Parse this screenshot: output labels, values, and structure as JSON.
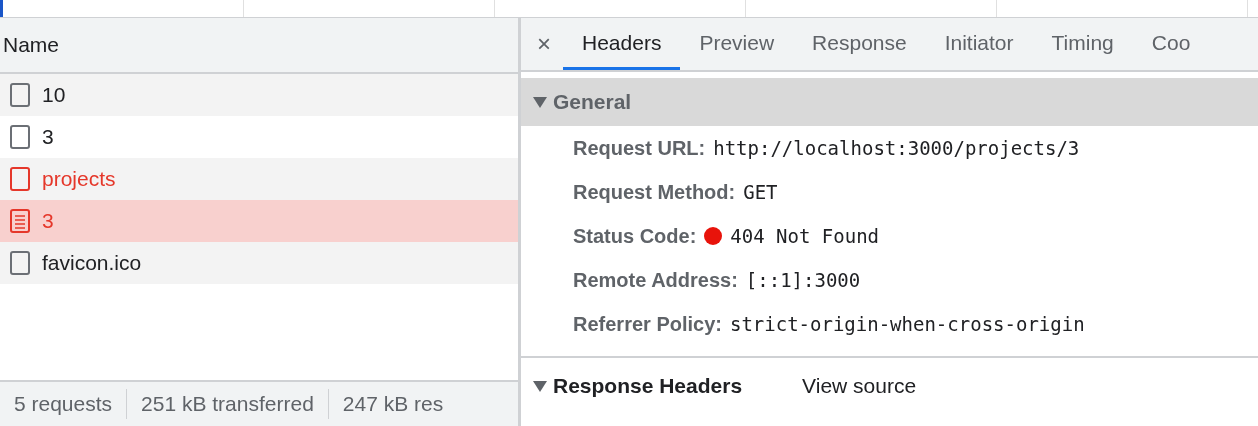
{
  "requests": {
    "column": "Name",
    "rows": [
      {
        "name": "10",
        "kind": "blank",
        "error": false,
        "selected": false
      },
      {
        "name": "3",
        "kind": "blank",
        "error": false,
        "selected": false
      },
      {
        "name": "projects",
        "kind": "blank",
        "error": true,
        "selected": false
      },
      {
        "name": "3",
        "kind": "document",
        "error": true,
        "selected": true
      },
      {
        "name": "favicon.ico",
        "kind": "blank",
        "error": false,
        "selected": false
      }
    ]
  },
  "status_bar": [
    "5 requests",
    "251 kB transferred",
    "247 kB res"
  ],
  "details": {
    "close": "×",
    "tabs": [
      {
        "label": "Headers",
        "selected": true
      },
      {
        "label": "Preview",
        "selected": false
      },
      {
        "label": "Response",
        "selected": false
      },
      {
        "label": "Initiator",
        "selected": false
      },
      {
        "label": "Timing",
        "selected": false
      },
      {
        "label": "Coo",
        "selected": false
      }
    ],
    "general": {
      "title": "General",
      "expanded": true,
      "fields": [
        {
          "label": "Request URL:",
          "value": "http://localhost:3000/projects/3"
        },
        {
          "label": "Request Method:",
          "value": "GET"
        },
        {
          "label": "Status Code:",
          "value": "404 Not Found",
          "color": "#e8130b"
        },
        {
          "label": "Remote Address:",
          "value": "[::1]:3000"
        },
        {
          "label": "Referrer Policy:",
          "value": "strict-origin-when-cross-origin"
        }
      ]
    },
    "response_headers": {
      "title": "Response Headers",
      "expanded": true,
      "link": "View source"
    }
  }
}
